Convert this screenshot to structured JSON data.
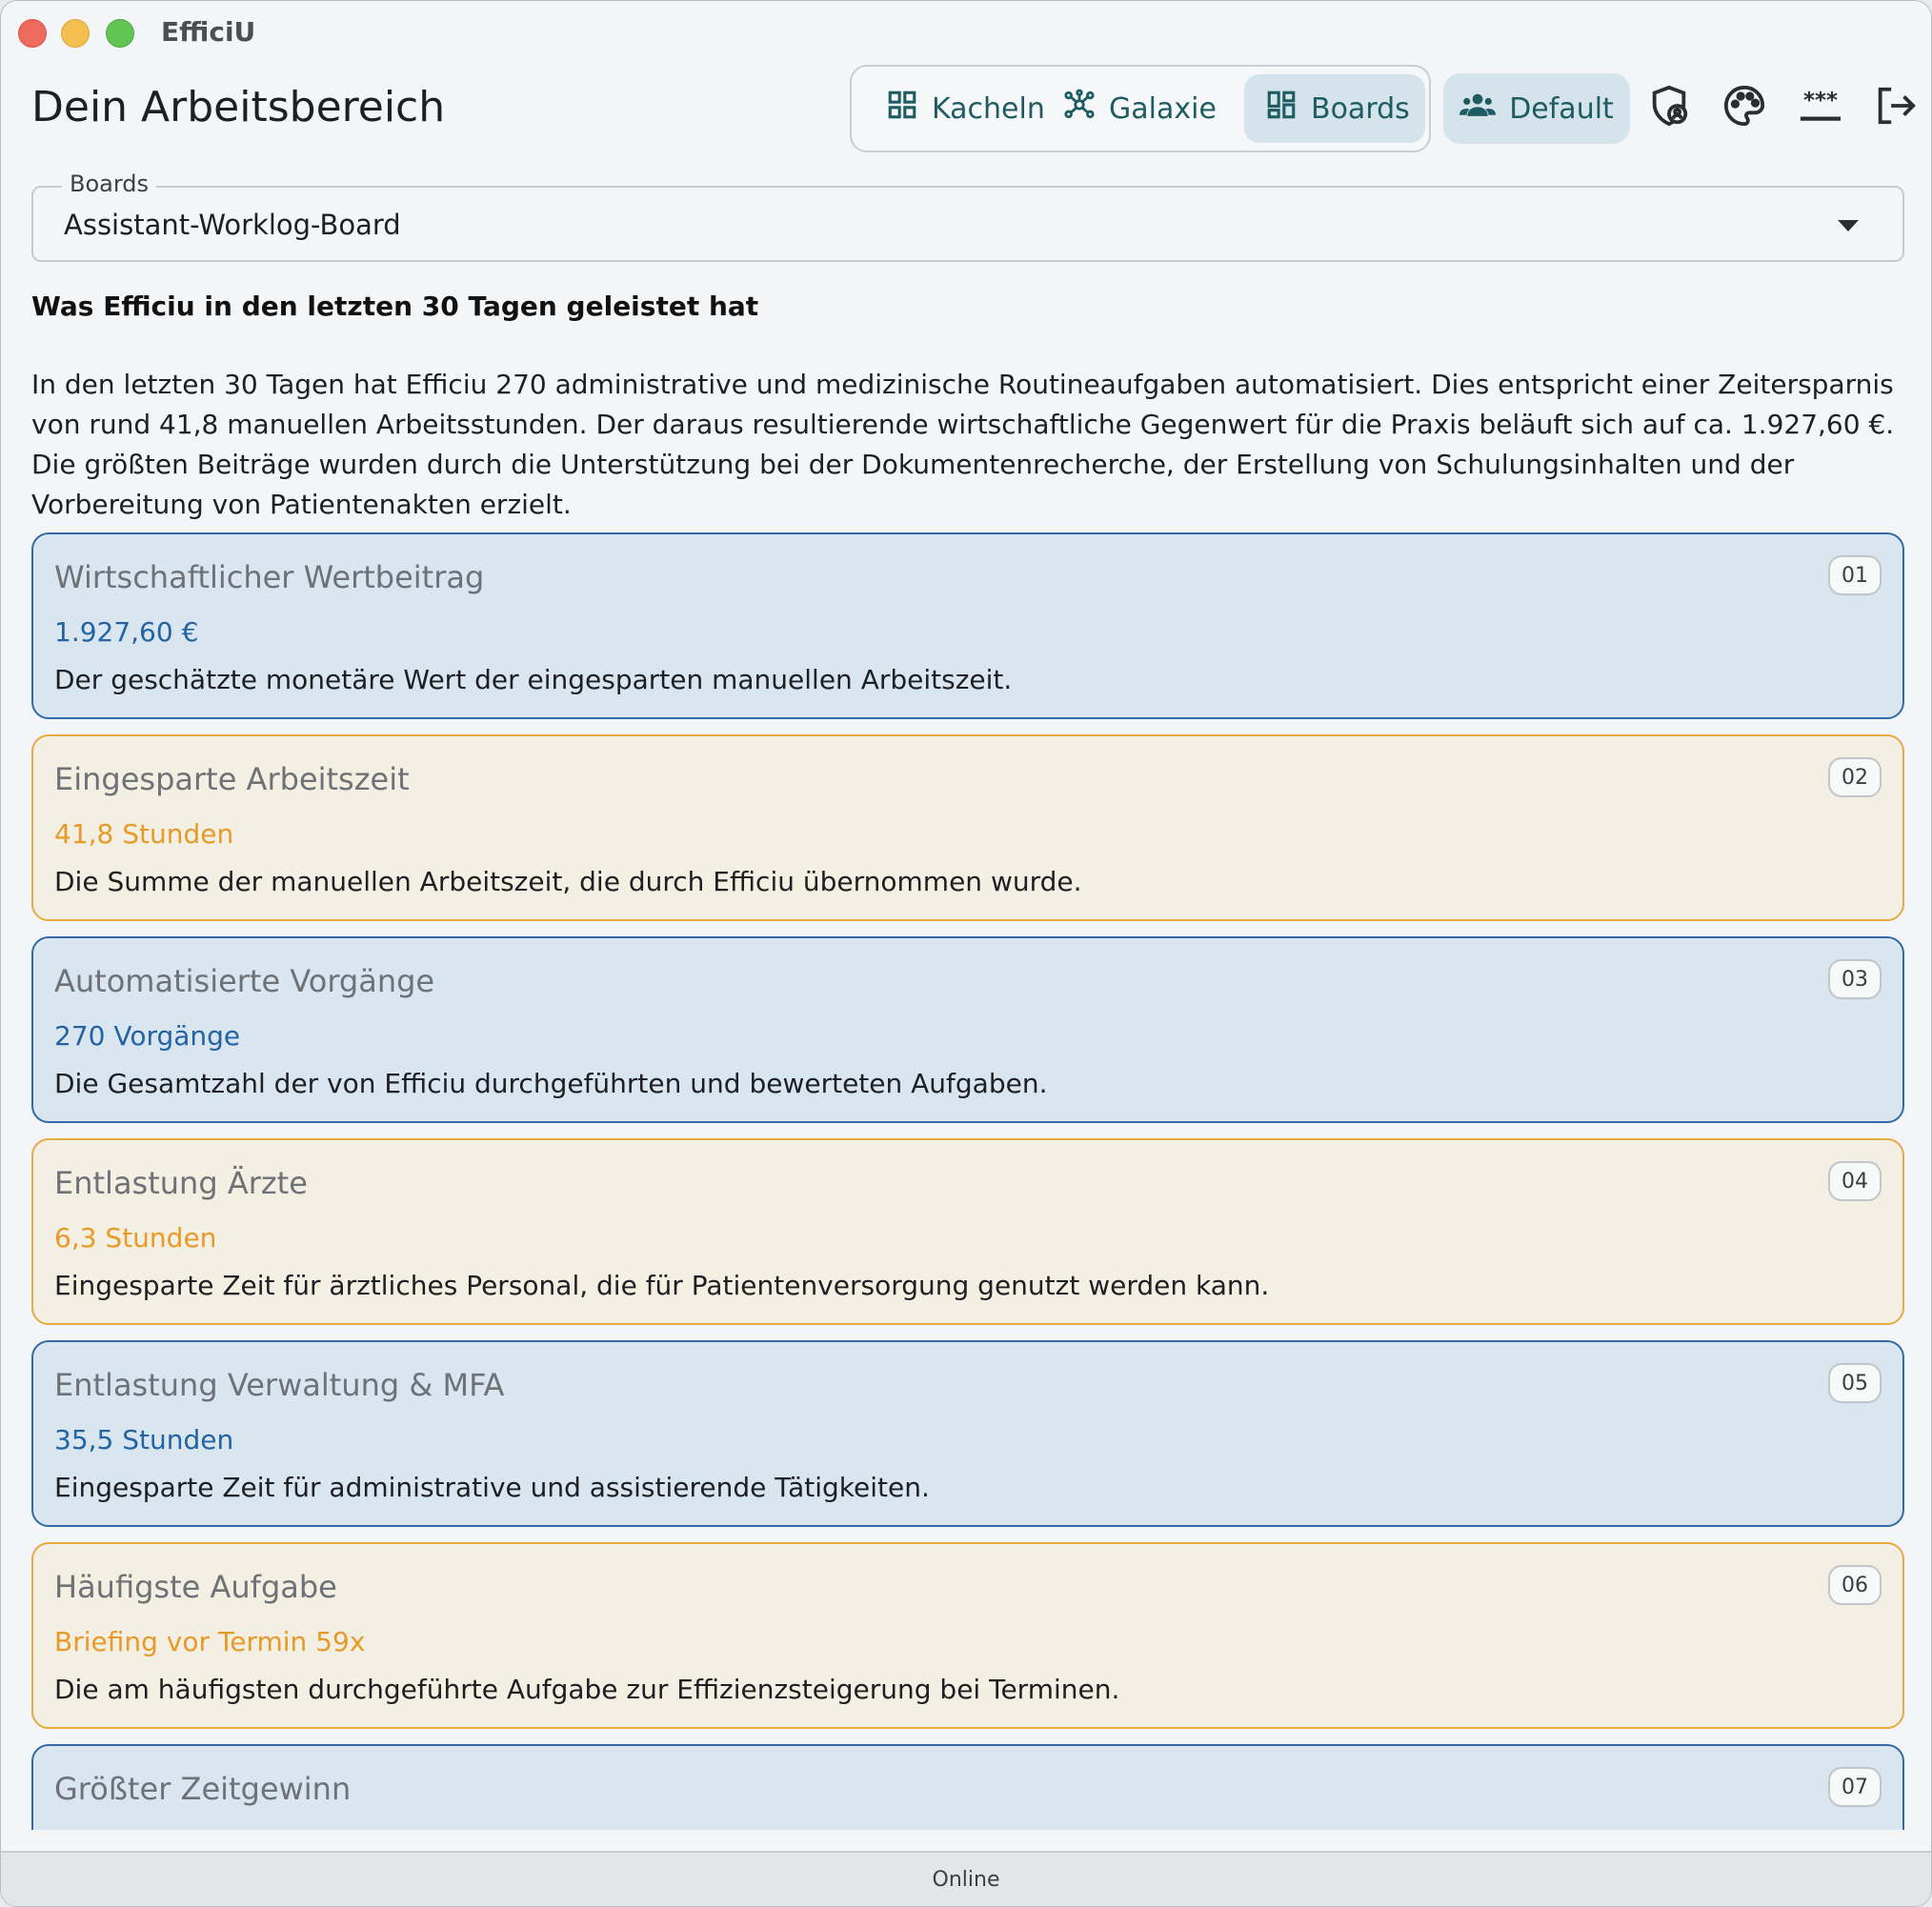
{
  "window": {
    "app_title": "EfficiU"
  },
  "header": {
    "page_title": "Dein Arbeitsbereich",
    "views": [
      {
        "label": "Kacheln",
        "icon": "grid-icon",
        "active": false
      },
      {
        "label": "Galaxie",
        "icon": "network-icon",
        "active": false
      },
      {
        "label": "Boards",
        "icon": "dashboard-icon",
        "active": true
      }
    ],
    "profile_button": {
      "label": "Default",
      "icon": "users-icon"
    },
    "icons": [
      "shield-user-icon",
      "palette-icon",
      "password-icon",
      "logout-icon"
    ]
  },
  "board_select": {
    "legend": "Boards",
    "value": "Assistant-Worklog-Board"
  },
  "summary": {
    "heading": "Was Efficiu in den letzten 30 Tagen geleistet hat",
    "text": "In den letzten 30 Tagen hat Efficiu 270 administrative und medizinische Routineaufgaben automatisiert. Dies entspricht einer Zeitersparnis von rund 41,8 manuellen Arbeitsstunden. Der daraus resultierende wirtschaftliche Gegenwert für die Praxis beläuft sich auf ca. 1.927,60 €. Die größten Beiträge wurden durch die Unterstützung bei der Dokumentenrecherche, der Erstellung von Schulungsinhalten und der Vorbereitung von Patientenakten erzielt."
  },
  "cards": [
    {
      "num": "01",
      "title": "Wirtschaftlicher Wertbeitrag",
      "value": "1.927,60 €",
      "desc": "Der geschätzte monetäre Wert der eingesparten manuellen Arbeitszeit.",
      "color": "blue"
    },
    {
      "num": "02",
      "title": "Eingesparte Arbeitszeit",
      "value": "41,8 Stunden",
      "desc": "Die Summe der manuellen Arbeitszeit, die durch Efficiu übernommen wurde.",
      "color": "orange"
    },
    {
      "num": "03",
      "title": "Automatisierte Vorgänge",
      "value": "270 Vorgänge",
      "desc": "Die Gesamtzahl der von Efficiu durchgeführten und bewerteten Aufgaben.",
      "color": "blue"
    },
    {
      "num": "04",
      "title": "Entlastung Ärzte",
      "value": "6,3 Stunden",
      "desc": "Eingesparte Zeit für ärztliches Personal, die für Patientenversorgung genutzt werden kann.",
      "color": "orange"
    },
    {
      "num": "05",
      "title": "Entlastung Verwaltung & MFA",
      "value": "35,5 Stunden",
      "desc": "Eingesparte Zeit für administrative und assistierende Tätigkeiten.",
      "color": "blue"
    },
    {
      "num": "06",
      "title": "Häufigste Aufgabe",
      "value": "Briefing vor Termin 59x",
      "desc": "Die am häufigsten durchgeführte Aufgabe zur Effizienzsteigerung bei Terminen.",
      "color": "orange"
    },
    {
      "num": "07",
      "title": "Größter Zeitgewinn",
      "value": "",
      "desc": "",
      "color": "blue"
    }
  ],
  "colors": {
    "accent": "#1e5c63",
    "card_blue_border": "#2e6ba8",
    "card_blue_bg": "#d9e6f0",
    "card_orange_border": "#e6a943",
    "card_orange_bg": "#f3efe2"
  },
  "status": {
    "text": "Online"
  }
}
